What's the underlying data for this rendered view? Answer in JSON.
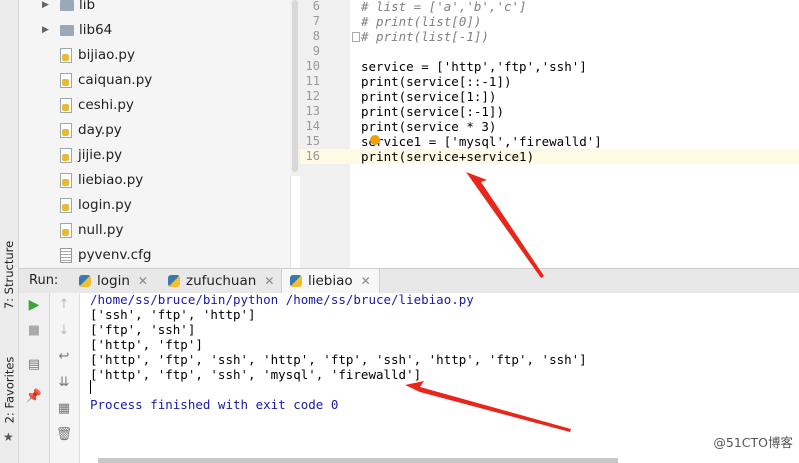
{
  "sidebar_tabs": {
    "structure": "7: Structure",
    "favorites": "2: Favorites"
  },
  "project_tree": [
    {
      "label": "lib",
      "type": "folder"
    },
    {
      "label": "lib64",
      "type": "folder"
    },
    {
      "label": "bijiao.py",
      "type": "py"
    },
    {
      "label": "caiquan.py",
      "type": "py"
    },
    {
      "label": "ceshi.py",
      "type": "py"
    },
    {
      "label": "day.py",
      "type": "py"
    },
    {
      "label": "jijie.py",
      "type": "py"
    },
    {
      "label": "liebiao.py",
      "type": "py"
    },
    {
      "label": "login.py",
      "type": "py"
    },
    {
      "label": "null.py",
      "type": "py"
    },
    {
      "label": "pyvenv.cfg",
      "type": "cfg"
    }
  ],
  "editor": {
    "line_numbers": [
      "6",
      "7",
      "8",
      "9",
      "10",
      "11",
      "12",
      "13",
      "14",
      "15",
      "16"
    ],
    "lines": [
      "# list = ['a','b','c']",
      "# print(list[0])",
      "# print(list[-1])",
      "",
      "service = ['http','ftp','ssh']",
      "print(service[::-1])",
      "print(service[1:])",
      "print(service[:-1])",
      "print(service * 3)",
      "service1 = ['mysql','firewalld']",
      "print(service+service1)"
    ]
  },
  "run_panel": {
    "label": "Run:",
    "tabs": [
      "login",
      "zufuchuan",
      "liebiao"
    ],
    "active_tab": "liebiao"
  },
  "console": {
    "command": "/home/ss/bruce/bin/python /home/ss/bruce/liebiao.py",
    "output": [
      "['ssh', 'ftp', 'http']",
      "['ftp', 'ssh']",
      "['http', 'ftp']",
      "['http', 'ftp', 'ssh', 'http', 'ftp', 'ssh', 'http', 'ftp', 'ssh']",
      "['http', 'ftp', 'ssh', 'mysql', 'firewalld']"
    ],
    "exit_message": "Process finished with exit code 0"
  },
  "watermark": "@51CTO博客",
  "colors": {
    "annotation_arrow": "#e8261c",
    "string": "#008000",
    "comment": "#808080",
    "console_info": "#1a1aa6"
  }
}
